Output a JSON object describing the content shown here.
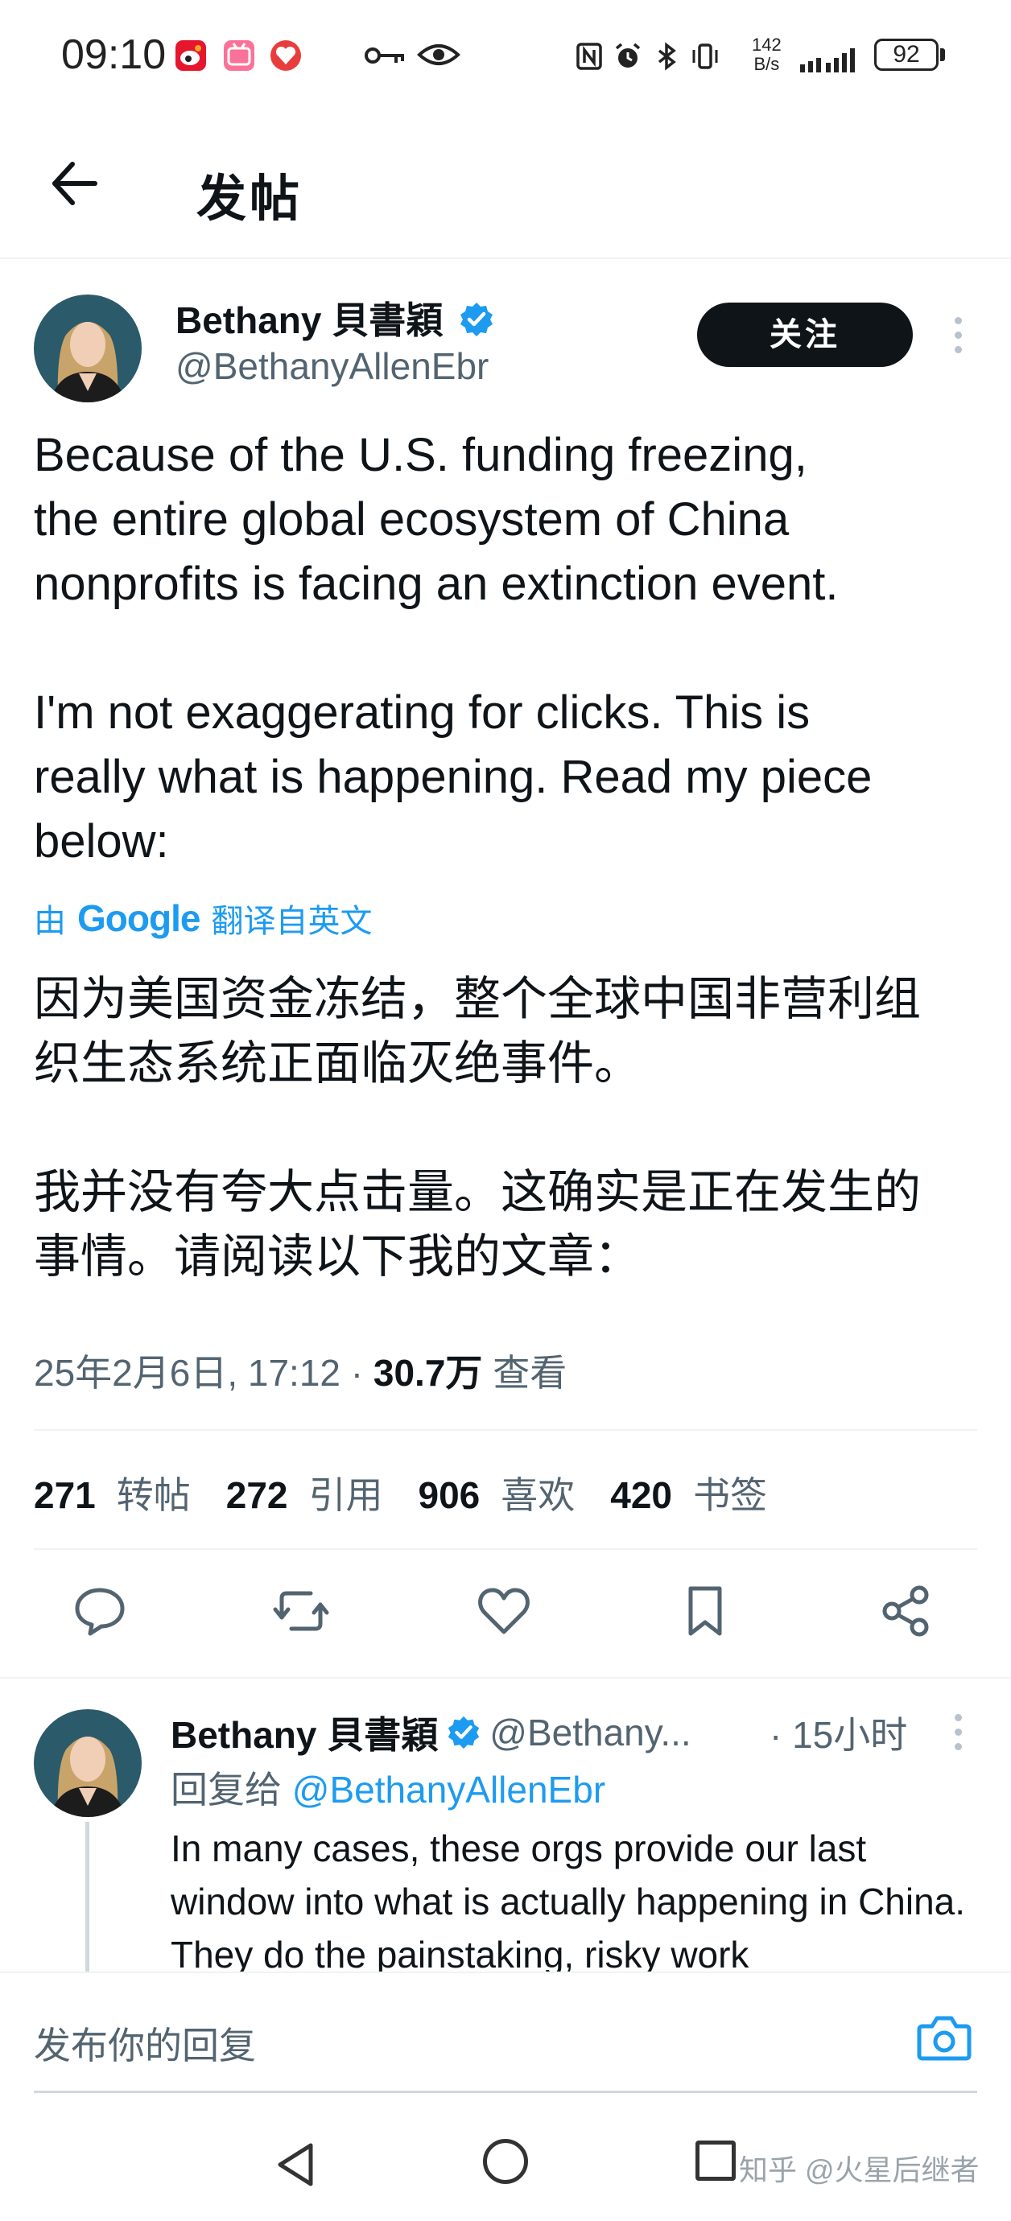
{
  "status_bar": {
    "time": "09:10",
    "net_speed_value": "142",
    "net_speed_unit": "B/s",
    "battery": "92",
    "apps": [
      "weibo-icon",
      "bilibili-icon",
      "red-app-icon"
    ]
  },
  "header": {
    "title": "发帖"
  },
  "tweet": {
    "author_name": "Bethany 貝書穎",
    "handle": "@BethanyAllenEbr",
    "follow_label": "关注",
    "text": "Because of the U.S. funding freezing,\nthe entire global ecosystem of China\nnonprofits is facing an extinction event.\n\nI'm not exaggerating for clicks. This is\nreally what is happening. Read my piece\nbelow:",
    "translate_prefix": "由",
    "translate_brand": "Google",
    "translate_suffix": "翻译自英文",
    "translated_text": "因为美国资金冻结，整个全球中国非营利组\n织生态系统正面临灭绝事件。\n\n我并没有夸大点击量。这确实是正在发生的\n事情。请阅读以下我的文章：",
    "date": "25年2月6日, 17:12 ·",
    "views": "30.7万",
    "views_label": "查看",
    "stats": {
      "retweets": "271",
      "retweets_label": "转帖",
      "quotes": "272",
      "quotes_label": "引用",
      "likes": "906",
      "likes_label": "喜欢",
      "bookmarks": "420",
      "bookmarks_label": "书签"
    }
  },
  "reply": {
    "author_name": "Bethany 貝書穎",
    "handle": "@Bethany...",
    "time": "· 15小时",
    "reply_to_prefix": "回复给",
    "reply_to_handle": "@BethanyAllenEbr",
    "text": "In many cases, these orgs provide our last window into what is actually happening in China. They do the painstaking, risky work"
  },
  "composer": {
    "placeholder": "发布你的回复"
  },
  "watermark": "知乎 @火星后继者",
  "colors": {
    "accent": "#1d9bf0",
    "text": "#0f1419",
    "muted": "#536471"
  }
}
